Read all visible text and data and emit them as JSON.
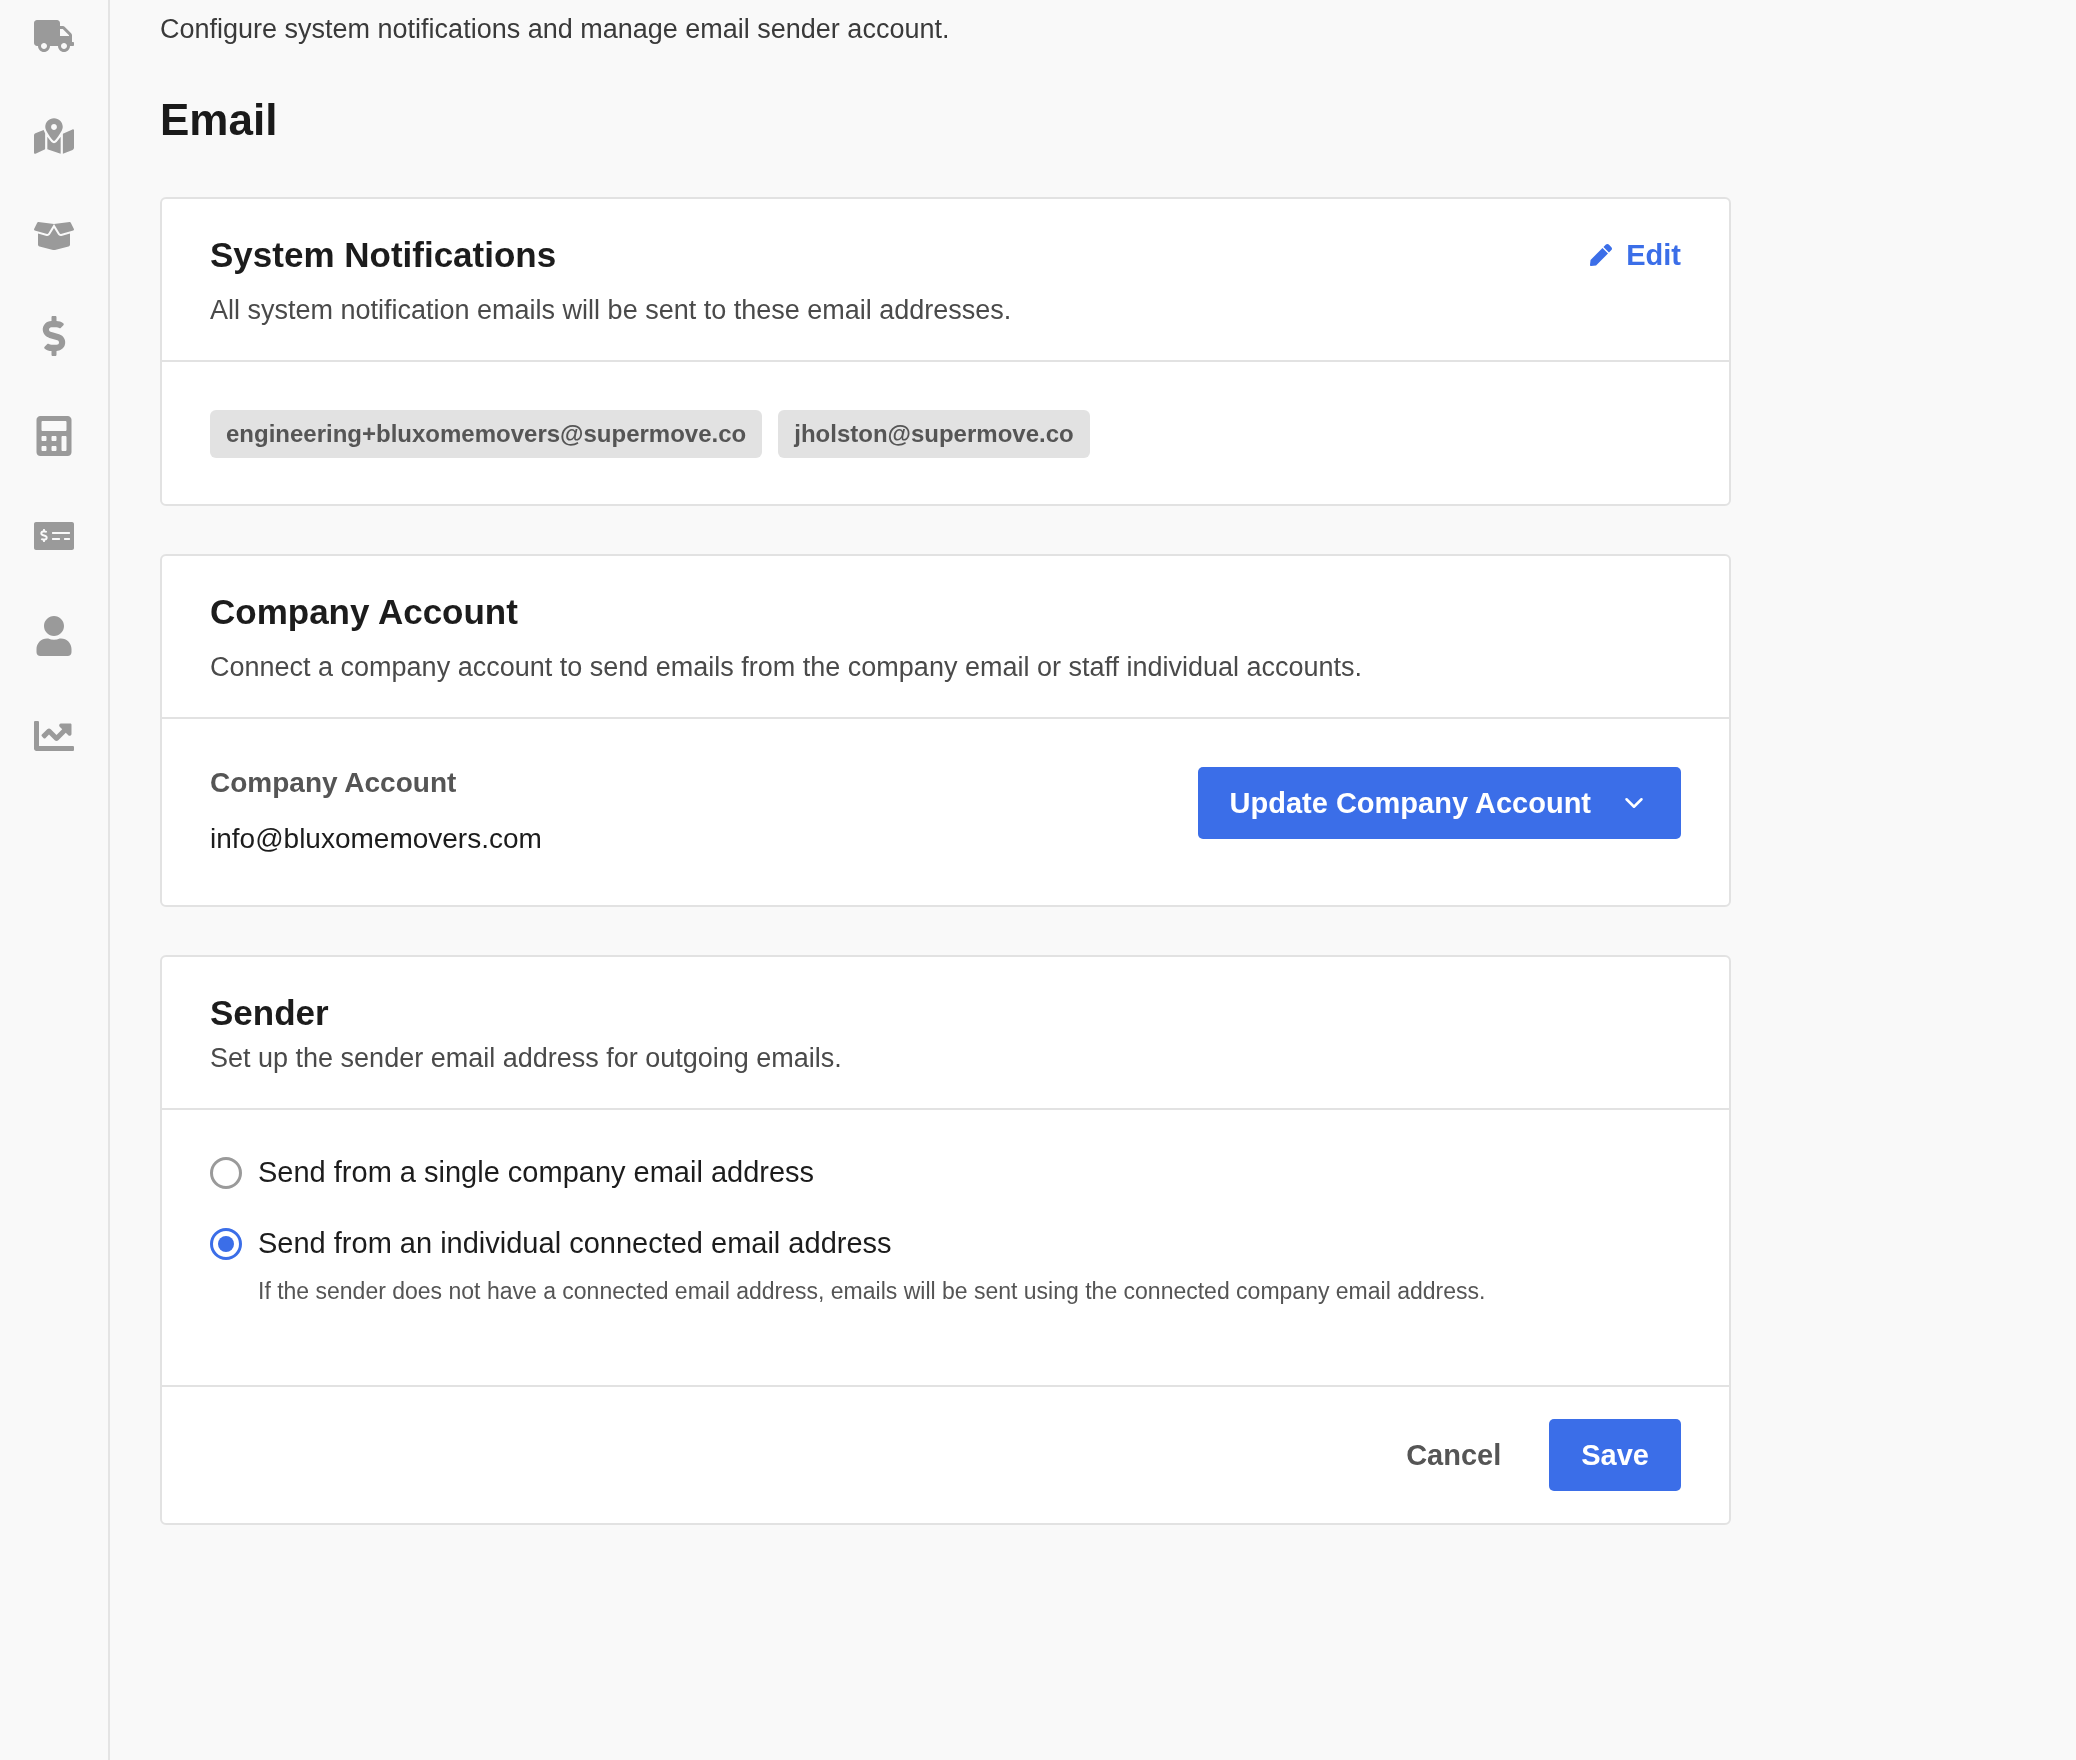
{
  "header": {
    "subtitle": "Configure system notifications and manage email sender account.",
    "title": "Email"
  },
  "system_notifications": {
    "title": "System Notifications",
    "description": "All system notification emails will be sent to these email addresses.",
    "edit_label": "Edit",
    "emails": [
      "engineering+bluxomemovers@supermove.co",
      "jholston@supermove.co"
    ]
  },
  "company_account": {
    "title": "Company Account",
    "description": "Connect a company account to send emails from the company email or staff individual accounts.",
    "field_label": "Company Account",
    "field_value": "info@bluxomemovers.com",
    "button": "Update Company Account"
  },
  "sender": {
    "title": "Sender",
    "description": "Set up the sender email address for outgoing emails.",
    "options": [
      {
        "label": "Send from a single company email address",
        "selected": false
      },
      {
        "label": "Send from an individual connected email address",
        "selected": true,
        "help": "If the sender does not have a connected email address, emails will be sent using the connected company email address."
      }
    ],
    "cancel": "Cancel",
    "save": "Save"
  }
}
